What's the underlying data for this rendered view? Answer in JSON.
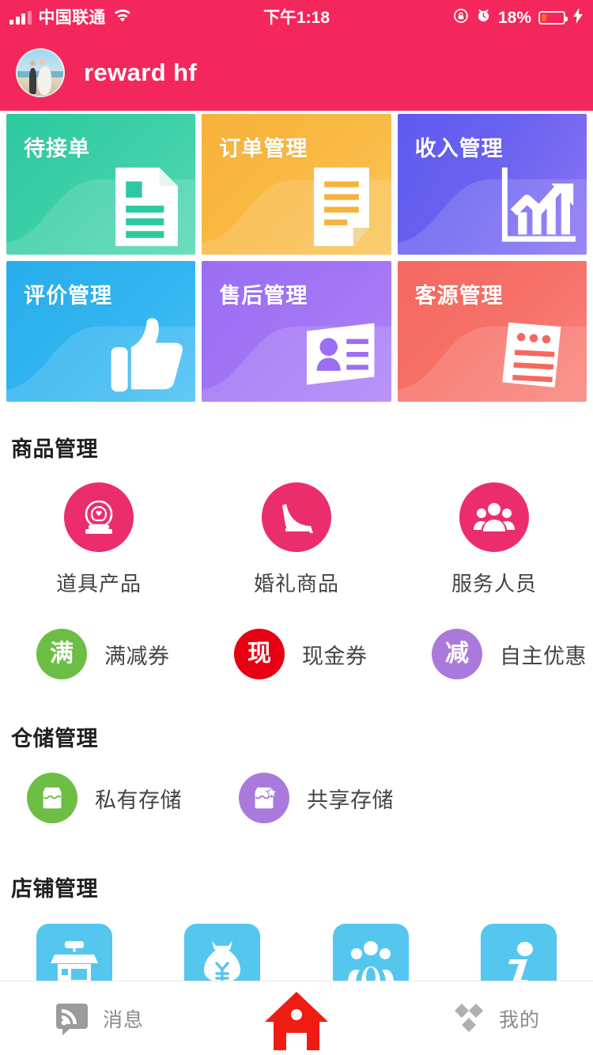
{
  "status_bar": {
    "carrier": "中国联通",
    "time": "下午1:18",
    "battery_percent": "18%",
    "icons": [
      "signal-bars-icon",
      "wifi-icon",
      "rotation-lock-icon",
      "alarm-clock-icon",
      "battery-icon",
      "charging-bolt-icon"
    ],
    "signal_bars_filled": 3,
    "signal_bars_total": 4,
    "battery_level": 18,
    "bar_color": "#F4275C",
    "battery_fill_color": "#FF6A2B"
  },
  "header": {
    "title": "reward hf",
    "avatar_alt": "wedding-couple-photo",
    "background_color": "#F4275C"
  },
  "tiles": [
    {
      "label": "待接单",
      "color": "#2DC9A0",
      "gradient_to": "#48D3AC",
      "icon": "document-lines-icon"
    },
    {
      "label": "订单管理",
      "color": "#F7B23B",
      "gradient_to": "#FBC155",
      "icon": "order-paper-icon"
    },
    {
      "label": "收入管理",
      "color": "#5E5BEE",
      "gradient_to": "#7C6CF2",
      "icon": "growth-chart-icon"
    },
    {
      "label": "评价管理",
      "color": "#28AEEC",
      "gradient_to": "#3FBDF5",
      "icon": "thumbs-up-icon"
    },
    {
      "label": "售后管理",
      "color": "#9B6EF3",
      "gradient_to": "#A97EF7",
      "icon": "id-card-icon"
    },
    {
      "label": "客源管理",
      "color": "#F4695F",
      "gradient_to": "#F87B70",
      "icon": "customer-list-icon"
    }
  ],
  "sections": {
    "product": {
      "title": "商品管理",
      "items": [
        {
          "label": "道具产品",
          "icon": "wedding-arch-icon",
          "color": "#EC2D6B"
        },
        {
          "label": "婚礼商品",
          "icon": "high-heel-shoe-icon",
          "color": "#EC2D6B"
        },
        {
          "label": "服务人员",
          "icon": "staff-people-icon",
          "color": "#EC2D6B"
        }
      ],
      "coupons": [
        {
          "badge": "满",
          "label": "满减券",
          "color": "#6CBE45"
        },
        {
          "badge": "现",
          "label": "现金券",
          "color": "#E60012"
        },
        {
          "badge": "减",
          "label": "自主优惠",
          "color": "#A97ADB"
        }
      ]
    },
    "storage": {
      "title": "仓储管理",
      "items": [
        {
          "label": "私有存储",
          "icon": "storage-box-icon",
          "color": "#6CBE45"
        },
        {
          "label": "共享存储",
          "icon": "shared-storage-box-icon",
          "color": "#A97ADB"
        }
      ]
    },
    "shop": {
      "title": "店铺管理",
      "items": [
        {
          "icon": "storefront-icon",
          "color": "#55C6ED"
        },
        {
          "icon": "money-bag-yuan-icon",
          "color": "#55C6ED"
        },
        {
          "icon": "people-group-icon",
          "color": "#55C6ED"
        },
        {
          "icon": "info-i-icon",
          "color": "#55C6ED"
        }
      ]
    }
  },
  "tabbar": {
    "items": [
      {
        "label": "消息",
        "icon": "rss-message-icon",
        "active": false,
        "color": "#9b9b9b"
      },
      {
        "label": "",
        "icon": "home-icon",
        "active": true,
        "color": "#EE1C12"
      },
      {
        "label": "我的",
        "icon": "diamond-cluster-icon",
        "active": false,
        "color": "#b0b0b0"
      }
    ]
  }
}
